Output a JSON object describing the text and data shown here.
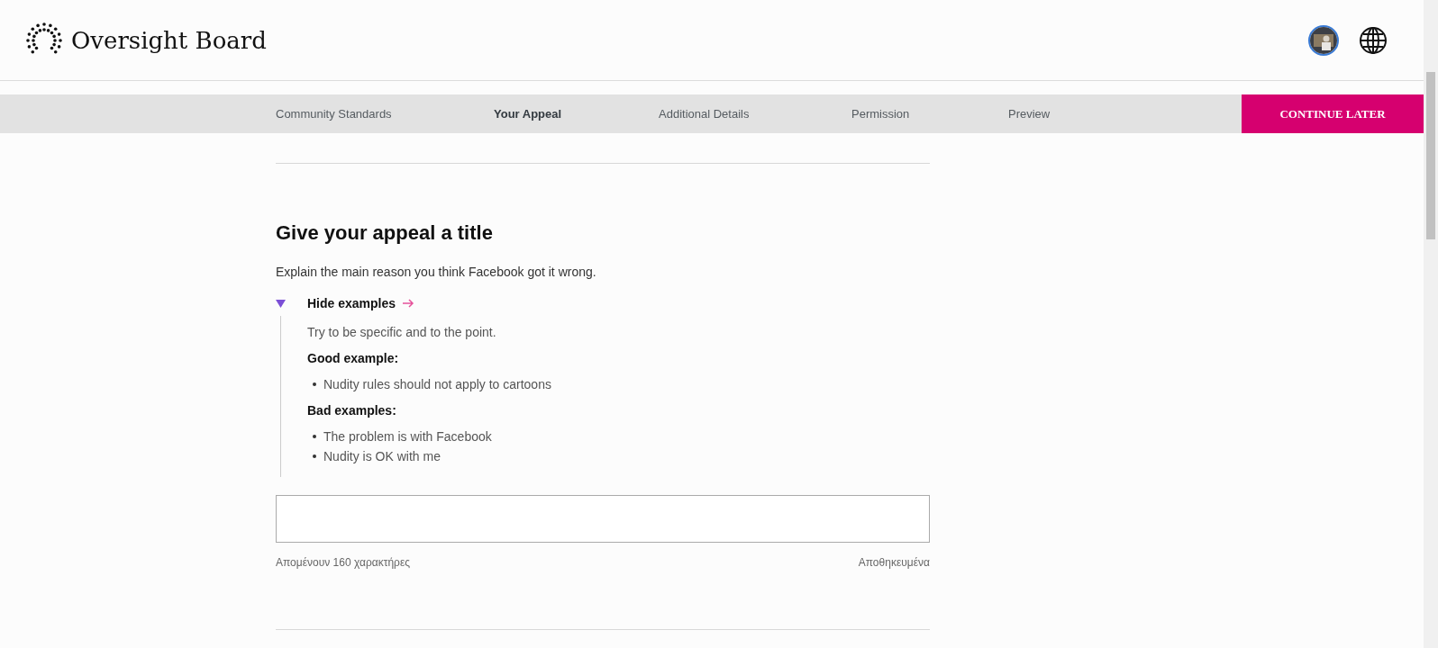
{
  "brand": {
    "name": "Oversight Board"
  },
  "steps": [
    {
      "label": "Community Standards",
      "selected": false
    },
    {
      "label": "Your Appeal",
      "selected": true
    },
    {
      "label": "Additional Details",
      "selected": false
    },
    {
      "label": "Permission",
      "selected": false
    },
    {
      "label": "Preview",
      "selected": false
    }
  ],
  "continue_button": "CONTINUE LATER",
  "section": {
    "title": "Give your appeal a title",
    "description": "Explain the main reason you think Facebook got it wrong.",
    "examples": {
      "toggle": "Hide examples",
      "expanded": true,
      "hint": "Try to be specific and to the point.",
      "groups": [
        {
          "heading": "Good example:",
          "items": [
            "Nudity rules should not apply to cartoons"
          ]
        },
        {
          "heading": "Bad examples:",
          "items": [
            "The problem is with Facebook",
            "Nudity is OK with me"
          ]
        }
      ]
    },
    "input": {
      "remaining": "Απομένουν 160 χαρακτήρες",
      "save_status": "Αποθηκευμένα"
    }
  }
}
